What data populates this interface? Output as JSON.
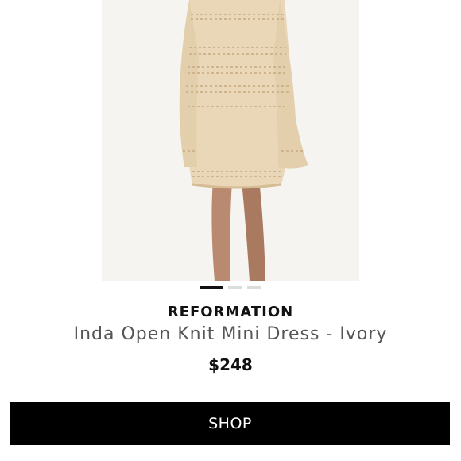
{
  "product": {
    "image_alt": "Model wearing ivory open knit long-sleeve mini dress",
    "brand": "REFORMATION",
    "title": "Inda Open Knit Mini Dress - Ivory",
    "price": "$248"
  },
  "carousel": {
    "total_images": 3,
    "active_index": 0
  },
  "actions": {
    "shop_label": "SHOP"
  },
  "colors": {
    "dot_active": "#111111",
    "dot_inactive": "#dcdcdc",
    "button_bg": "#000000",
    "button_text": "#ffffff",
    "dress": "#e8d6b6"
  }
}
